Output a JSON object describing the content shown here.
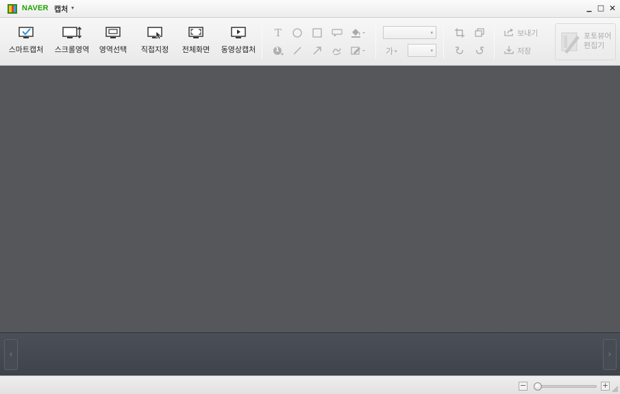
{
  "titlebar": {
    "brand": "NAVER",
    "product": "캡처",
    "menu_chevron": "▾",
    "minimize": "▁",
    "maximize": "□",
    "close": "✕"
  },
  "capture_tools": [
    {
      "label": "스마트캡처",
      "icon": "smart-capture-icon"
    },
    {
      "label": "스크롤영역",
      "icon": "scroll-area-icon"
    },
    {
      "label": "영역선택",
      "icon": "region-select-icon"
    },
    {
      "label": "직접지정",
      "icon": "manual-select-icon"
    },
    {
      "label": "전체화면",
      "icon": "fullscreen-icon"
    },
    {
      "label": "동영상캡처",
      "icon": "video-capture-icon"
    }
  ],
  "draw_tools": {
    "text": "T",
    "number": "1"
  },
  "format": {
    "font_label": "가",
    "arrow": "▾",
    "font_family_value": "",
    "font_size_value": ""
  },
  "actions": {
    "send": "보내기",
    "save": "저장",
    "photo_editor_line1": "포토뷰어",
    "photo_editor_line2": "편집기"
  },
  "strip": {
    "prev": "‹",
    "next": "›"
  },
  "zoom": {
    "minus": "−",
    "plus": "+",
    "level": 0.05
  },
  "colors": {
    "brand_green": "#1ea100",
    "canvas_bg": "#56575b",
    "strip_bg": "#454950",
    "accent_blue": "#2f8fd8"
  }
}
